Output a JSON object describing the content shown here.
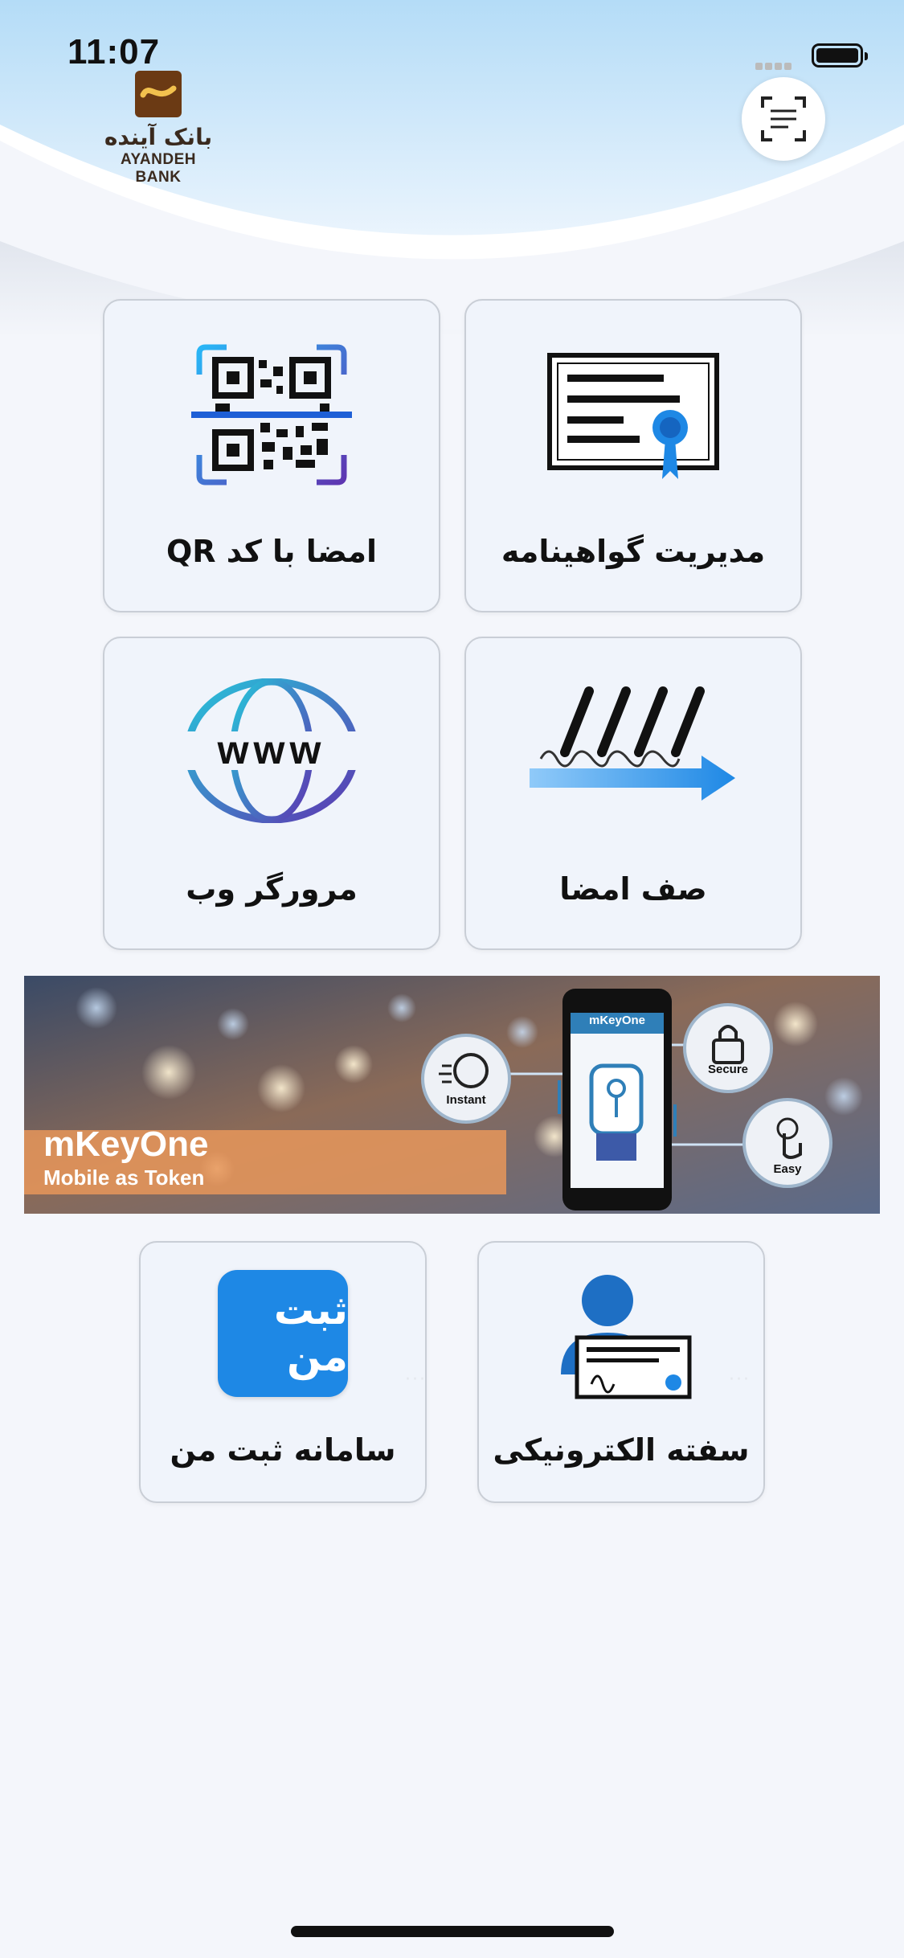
{
  "status_bar": {
    "time": "11:07"
  },
  "brand": {
    "name_fa": "بانک آینده",
    "name_en": "AYANDEH BANK"
  },
  "tiles": [
    {
      "label": "مدیریت گواهینامه",
      "icon": "certificate-icon"
    },
    {
      "label": "امضا با کد QR",
      "icon": "qr-code-icon"
    },
    {
      "label": "صف امضا",
      "icon": "signature-queue-icon"
    },
    {
      "label": "مرورگر وب",
      "icon": "globe-www-icon"
    },
    {
      "label": "سفته الکترونیکی",
      "icon": "electronic-promissory-note-icon"
    },
    {
      "label": "سامانه ثبت من",
      "icon": "sabt-man-icon"
    }
  ],
  "banner": {
    "title": "mKeyOne",
    "subtitle": "Mobile as Token",
    "phone_header": "mKeyOne",
    "badges": [
      "Instant",
      "Secure",
      "Easy"
    ]
  },
  "sabt_man_logo_text": "ثبت من",
  "colors": {
    "accent_blue": "#1e88e5",
    "tile_bg": "#f0f4fb",
    "banner_orange": "#e8975a"
  }
}
